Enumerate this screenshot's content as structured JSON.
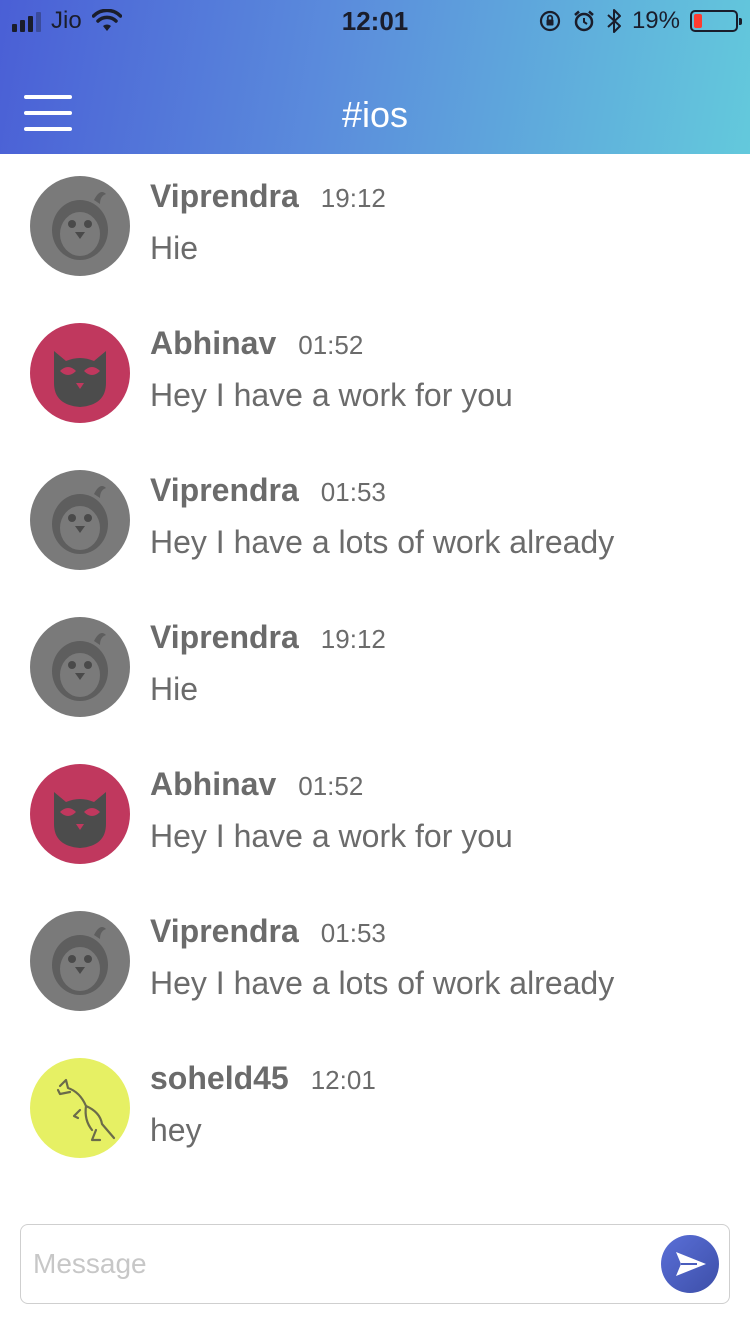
{
  "status_bar": {
    "carrier": "Jio",
    "time": "12:01",
    "battery_percent": "19%",
    "battery_level": 0.19,
    "icons": [
      "signal-icon",
      "wifi-icon",
      "orientation-lock-icon",
      "alarm-icon",
      "bluetooth-icon",
      "battery-icon"
    ]
  },
  "header": {
    "title": "#ios",
    "colors": {
      "gradient_start": "#4a5fd6",
      "gradient_end": "#63c9dc"
    }
  },
  "messages": [
    {
      "author": "Viprendra",
      "time": "19:12",
      "text": "Hie",
      "avatar": "penguin",
      "avatar_color": "#7a7a7a"
    },
    {
      "author": "Abhinav",
      "time": "01:52",
      "text": "Hey I have a work for you",
      "avatar": "owl",
      "avatar_color": "#c0385e"
    },
    {
      "author": "Viprendra",
      "time": "01:53",
      "text": "Hey I have a lots of work already",
      "avatar": "penguin",
      "avatar_color": "#7a7a7a"
    },
    {
      "author": "Viprendra",
      "time": "19:12",
      "text": "Hie",
      "avatar": "penguin",
      "avatar_color": "#7a7a7a"
    },
    {
      "author": "Abhinav",
      "time": "01:52",
      "text": "Hey I have a work for you",
      "avatar": "owl",
      "avatar_color": "#c0385e"
    },
    {
      "author": "Viprendra",
      "time": "01:53",
      "text": "Hey I have a lots of work already",
      "avatar": "penguin",
      "avatar_color": "#7a7a7a"
    },
    {
      "author": "soheld45",
      "time": "12:01",
      "text": "hey",
      "avatar": "kangaroo",
      "avatar_color": "#e6f064"
    }
  ],
  "composer": {
    "placeholder": "Message",
    "value": "",
    "send_icon": "send-icon"
  }
}
